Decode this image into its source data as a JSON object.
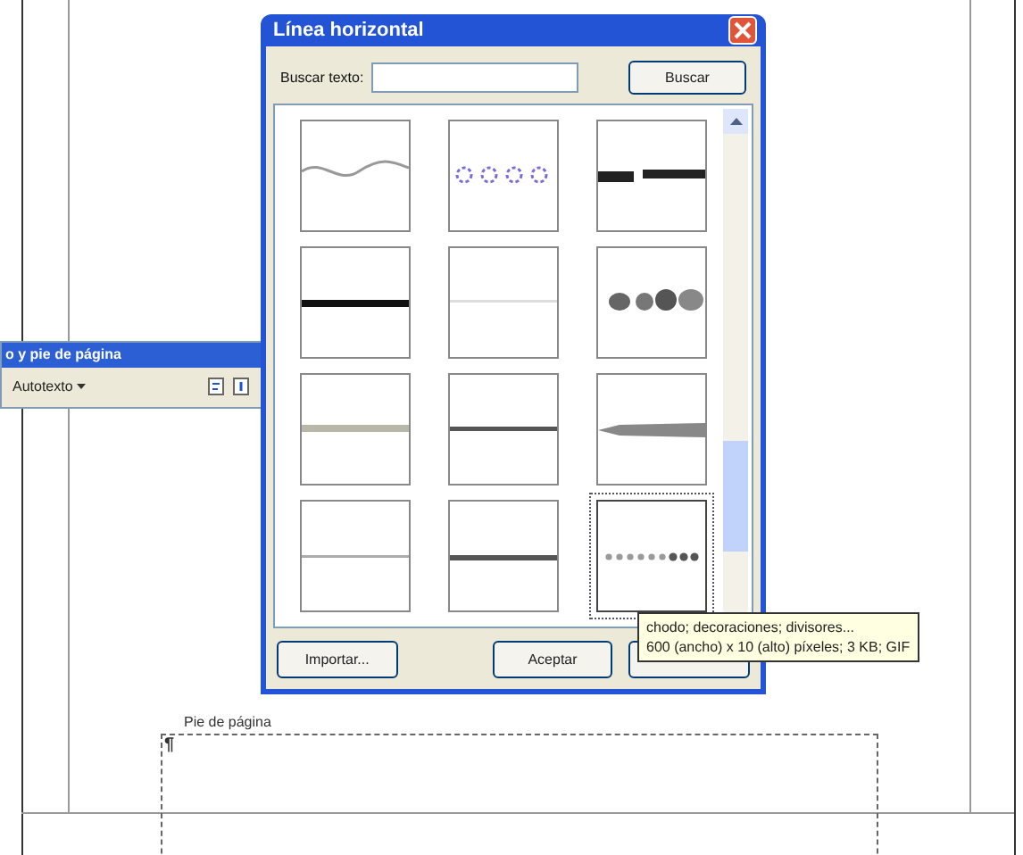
{
  "document": {
    "footer_label": "Pie de página",
    "paragraph_mark": "¶"
  },
  "toolbar": {
    "title": "o y pie de página",
    "autotext": "Autotexto"
  },
  "dialog": {
    "title": "Línea horizontal",
    "search_label": "Buscar texto:",
    "search_button": "Buscar",
    "items": [
      {
        "kind": "wave",
        "selected": false
      },
      {
        "kind": "rings",
        "selected": false
      },
      {
        "kind": "broken",
        "selected": false
      },
      {
        "kind": "thick",
        "selected": false
      },
      {
        "kind": "faint",
        "selected": false
      },
      {
        "kind": "blobs",
        "selected": false
      },
      {
        "kind": "bar",
        "selected": false
      },
      {
        "kind": "dark",
        "selected": false
      },
      {
        "kind": "taper",
        "selected": false
      },
      {
        "kind": "thin",
        "selected": false
      },
      {
        "kind": "medium",
        "selected": false
      },
      {
        "kind": "beads",
        "selected": true
      }
    ],
    "buttons": [
      {
        "label": "Importar..."
      },
      {
        "label": "Aceptar"
      }
    ],
    "tooltip": [
      "chodo; decoraciones; divisores...",
      "600 (ancho) x 10 (alto) píxeles; 3 KB; GIF"
    ]
  }
}
